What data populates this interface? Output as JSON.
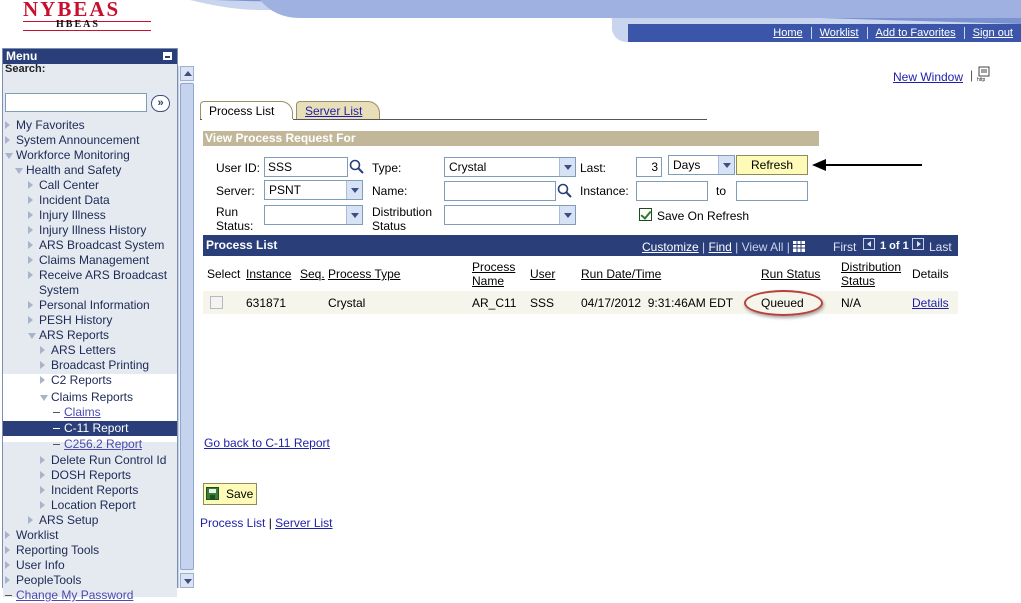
{
  "header": {
    "logo_top": "NYBEAS",
    "logo_bottom": "HBEAS",
    "nav": [
      "Home",
      "Worklist",
      "Add to Favorites",
      "Sign out"
    ],
    "brand_color": "#c8102e",
    "nav_color": "#3b55a8"
  },
  "menu": {
    "title": "Menu",
    "search_label": "Search:",
    "search_value": "",
    "items": [
      {
        "label": "My Favorites",
        "state": "collapsed"
      },
      {
        "label": "System Announcement",
        "state": "collapsed"
      },
      {
        "label": "Workforce Monitoring",
        "state": "expanded"
      },
      {
        "label": "Health and Safety",
        "state": "expanded"
      },
      {
        "label": "Call Center",
        "state": "collapsed"
      },
      {
        "label": "Incident Data",
        "state": "collapsed"
      },
      {
        "label": "Injury Illness",
        "state": "collapsed"
      },
      {
        "label": "Injury Illness History",
        "state": "collapsed"
      },
      {
        "label": "ARS Broadcast System",
        "state": "collapsed"
      },
      {
        "label": "Claims Management",
        "state": "collapsed"
      },
      {
        "label": "Receive ARS Broadcast System",
        "state": "collapsed"
      },
      {
        "label": "Personal Information",
        "state": "collapsed"
      },
      {
        "label": "PESH History",
        "state": "collapsed"
      },
      {
        "label": "ARS Reports",
        "state": "expanded"
      },
      {
        "label": "ARS Letters",
        "state": "collapsed"
      },
      {
        "label": "Broadcast Printing",
        "state": "collapsed"
      },
      {
        "label": "C2 Reports",
        "state": "collapsed"
      },
      {
        "label": "Claims Reports",
        "state": "expanded"
      },
      {
        "label": "Claims",
        "state": "leaf"
      },
      {
        "label": "C-11 Report",
        "state": "selected"
      },
      {
        "label": "C256.2 Report",
        "state": "leaf"
      },
      {
        "label": "Delete Run Control Id",
        "state": "collapsed"
      },
      {
        "label": "DOSH Reports",
        "state": "collapsed"
      },
      {
        "label": "Incident Reports",
        "state": "collapsed"
      },
      {
        "label": "Location Report",
        "state": "collapsed"
      },
      {
        "label": "ARS Setup",
        "state": "collapsed"
      },
      {
        "label": "Worklist",
        "state": "collapsed"
      },
      {
        "label": "Reporting Tools",
        "state": "collapsed"
      },
      {
        "label": "User Info",
        "state": "collapsed"
      },
      {
        "label": "PeopleTools",
        "state": "collapsed"
      },
      {
        "label": "Change My Password",
        "state": "leaf"
      }
    ]
  },
  "main": {
    "new_window": "New Window",
    "tabs": [
      "Process List",
      "Server List"
    ],
    "section_title": "View Process Request For",
    "filters": {
      "user_id_label": "User ID:",
      "user_id_value": "SSS",
      "type_label": "Type:",
      "type_value": "Crystal",
      "last_label": "Last:",
      "last_value": "3",
      "last_unit": "Days",
      "refresh": "Refresh",
      "server_label": "Server:",
      "server_value": "PSNT",
      "name_label": "Name:",
      "name_value": "",
      "instance_label": "Instance:",
      "instance_from": "",
      "to_label": "to",
      "instance_to": "",
      "run_status_label_1": "Run",
      "run_status_label_2": "Status:",
      "run_status_value": "",
      "dist_status_label_1": "Distribution",
      "dist_status_label_2": "Status",
      "dist_status_value": "",
      "save_on_refresh": "Save On Refresh",
      "save_on_refresh_checked": true
    },
    "grid": {
      "title": "Process List",
      "customize": "Customize",
      "find": "Find",
      "view_all": "View All",
      "first": "First",
      "page_info": "1 of 1",
      "last": "Last",
      "columns": {
        "select": "Select",
        "instance": "Instance",
        "seq": "Seq.",
        "process_type": "Process Type",
        "process_name_1": "Process",
        "process_name_2": "Name",
        "user": "User",
        "run_datetime": "Run Date/Time",
        "run_status": "Run Status",
        "dist_status_1": "Distribution",
        "dist_status_2": "Status",
        "details": "Details"
      },
      "rows": [
        {
          "instance": "631871",
          "seq": "",
          "process_type": "Crystal",
          "process_name": "AR_C11",
          "user": "SSS",
          "run_datetime": "04/17/2012  9:31:46AM EDT",
          "run_status": "Queued",
          "dist_status": "N/A",
          "details": "Details"
        }
      ]
    },
    "go_back": "Go back to C-11 Report",
    "save": "Save",
    "footer_links": [
      "Process List",
      "Server List"
    ]
  }
}
